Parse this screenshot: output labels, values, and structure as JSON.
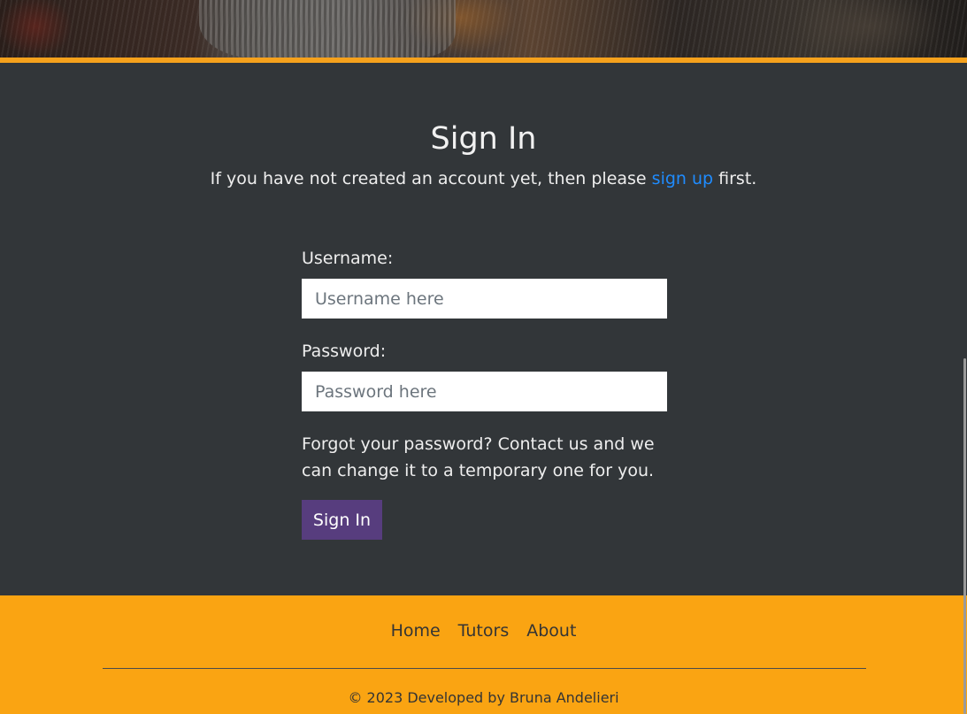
{
  "page": {
    "title": "Sign In",
    "intro_before": "If you have not created an account yet, then please ",
    "intro_link": "sign up",
    "intro_after": " first."
  },
  "form": {
    "username_label": "Username:",
    "username_placeholder": "Username here",
    "username_value": "",
    "password_label": "Password:",
    "password_placeholder": "Password here",
    "password_value": "",
    "forgot_text": "Forgot your password? Contact us and we can change it to a temporary one for you.",
    "submit_label": "Sign In"
  },
  "footer": {
    "nav": [
      {
        "label": "Home"
      },
      {
        "label": "Tutors"
      },
      {
        "label": "About"
      }
    ],
    "copyright": "© 2023 Developed by Bruna Andelieri"
  },
  "colors": {
    "accent": "#f5a11c",
    "background": "#323639",
    "link": "#1f8cff",
    "button": "#573d7e"
  }
}
